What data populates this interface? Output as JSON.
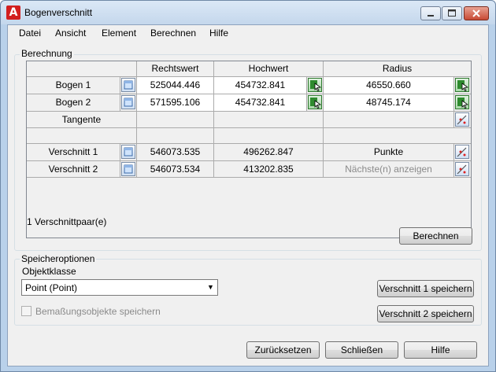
{
  "window": {
    "title": "Bogenverschnitt",
    "app_icon_letter": "A"
  },
  "menu": [
    "Datei",
    "Ansicht",
    "Element",
    "Berechnen",
    "Hilfe"
  ],
  "berechnung": {
    "group_label": "Berechnung",
    "columns": [
      "Rechtswert",
      "Hochwert",
      "Radius"
    ],
    "rows": [
      {
        "label": "Bogen 1",
        "rechtswert": "525044.446",
        "hochwert": "454732.841",
        "radius": "46550.660"
      },
      {
        "label": "Bogen 2",
        "rechtswert": "571595.106",
        "hochwert": "454732.841",
        "radius": "48745.174"
      },
      {
        "label": "Tangente",
        "rechtswert": "",
        "hochwert": "",
        "radius": ""
      },
      {
        "label": "",
        "rechtswert": "",
        "hochwert": "",
        "radius": ""
      },
      {
        "label": "Verschnitt 1",
        "rechtswert": "546073.535",
        "hochwert": "496262.847",
        "radius": "Punkte"
      },
      {
        "label": "Verschnitt 2",
        "rechtswert": "546073.534",
        "hochwert": "413202.835",
        "radius": "Nächste(n) anzeigen"
      }
    ],
    "status": "1 Verschnittpaar(e)",
    "berechnen_button": "Berechnen"
  },
  "speicheroptionen": {
    "group_label": "Speicheroptionen",
    "objektklasse_label": "Objektklasse",
    "objektklasse_value": "Point (Point)",
    "save1_button": "Verschnitt 1 speichern",
    "save2_button": "Verschnitt 2 speichern",
    "checkbox_label": "Bemaßungsobjekte speichern",
    "checkbox_checked": false
  },
  "footer": {
    "reset_button": "Zurücksetzen",
    "close_button": "Schließen",
    "help_button": "Hilfe"
  }
}
